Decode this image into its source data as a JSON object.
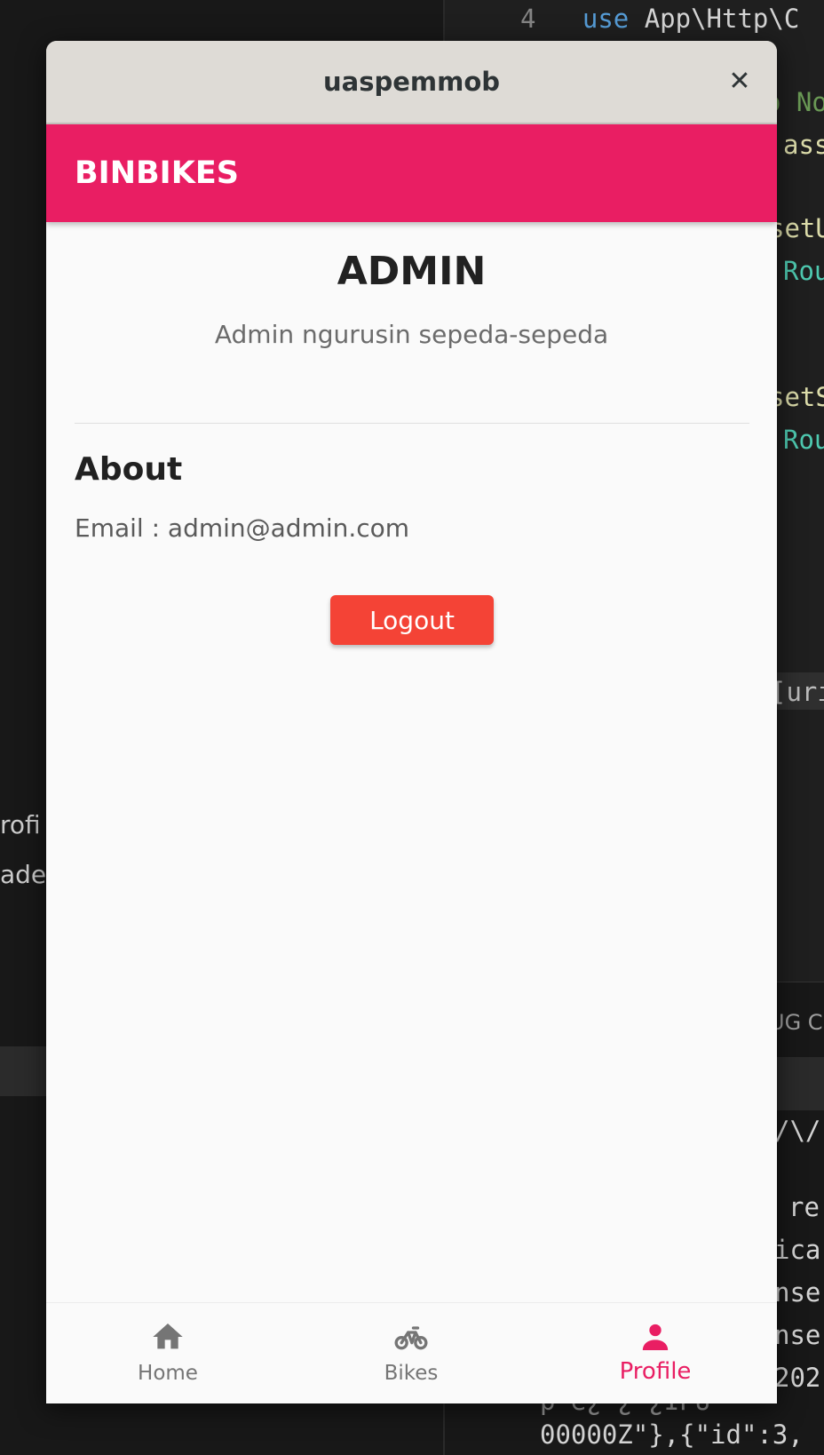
{
  "background": {
    "left_text": [
      "rofi",
      "ade."
    ],
    "code_lines": [
      {
        "lineno": "4",
        "kw": "use",
        "text": "App\\Http\\C"
      },
      {
        "text": "o No"
      },
      {
        "text": "ass"
      },
      {
        "text": "setU"
      },
      {
        "text": "Rou"
      },
      {
        "text": "setS"
      },
      {
        "text": "Rou"
      },
      {
        "text": "[uri"
      },
      {
        "text": "UG C"
      },
      {
        "text": "/\\/"
      },
      {
        "text": "re"
      },
      {
        "text": "ica"
      },
      {
        "text": "nse"
      },
      {
        "text": "nse"
      },
      {
        "text": "202"
      },
      {
        "text": "p\"e¿\"¿\"¿IPU"
      },
      {
        "text": "00000Z\"},{\"id\":3,"
      }
    ]
  },
  "window": {
    "title": "uaspemmob",
    "close_glyph": "✕"
  },
  "app": {
    "title": "BINBIKES",
    "accent_color": "#e91e63",
    "profile": {
      "name": "ADMIN",
      "description": "Admin ngurusin sepeda-sepeda"
    },
    "about": {
      "heading": "About",
      "email_line": "Email : admin@admin.com"
    },
    "logout_label": "Logout",
    "logout_color": "#f44336",
    "nav": {
      "items": [
        {
          "label": "Home",
          "icon": "home-icon",
          "active": false
        },
        {
          "label": "Bikes",
          "icon": "bike-icon",
          "active": false
        },
        {
          "label": "Profile",
          "icon": "person-icon",
          "active": true
        }
      ]
    }
  }
}
